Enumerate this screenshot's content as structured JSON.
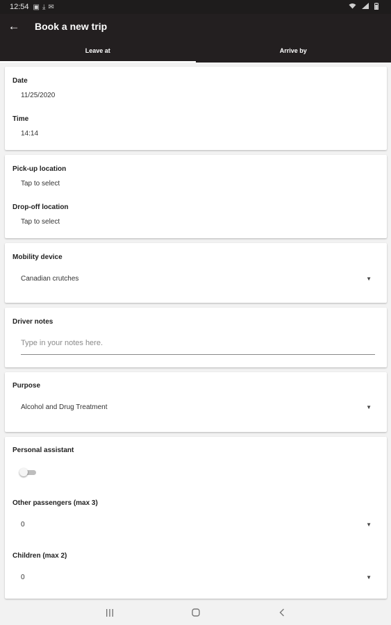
{
  "status_bar": {
    "time": "12:54",
    "icons_left": [
      "image-icon",
      "download-icon",
      "email-icon"
    ],
    "icons_right": [
      "wifi-icon",
      "signal-icon",
      "battery-icon"
    ]
  },
  "app_bar": {
    "back_icon": "arrow-left-icon",
    "title": "Book a new trip"
  },
  "tabs": [
    {
      "label": "Leave at",
      "active": true
    },
    {
      "label": "Arrive by",
      "active": false
    }
  ],
  "datetime": {
    "date_label": "Date",
    "date_value": "11/25/2020",
    "time_label": "Time",
    "time_value": "14:14"
  },
  "locations": {
    "pickup_label": "Pick-up location",
    "pickup_value": "Tap to select",
    "dropoff_label": "Drop-off location",
    "dropoff_value": "Tap to select"
  },
  "mobility": {
    "label": "Mobility device",
    "value": "Canadian crutches"
  },
  "driver_notes": {
    "label": "Driver notes",
    "placeholder": "Type in your notes here."
  },
  "purpose": {
    "label": "Purpose",
    "value": "Alcohol and Drug Treatment"
  },
  "extras": {
    "assistant_label": "Personal assistant",
    "assistant_enabled": false,
    "passengers_label": "Other passengers (max 3)",
    "passengers_value": "0",
    "children_label": "Children (max 2)",
    "children_value": "0"
  },
  "nav_bar": {
    "recents_icon": "recent-apps-icon",
    "home_icon": "home-icon",
    "back_icon": "back-chevron-icon"
  }
}
